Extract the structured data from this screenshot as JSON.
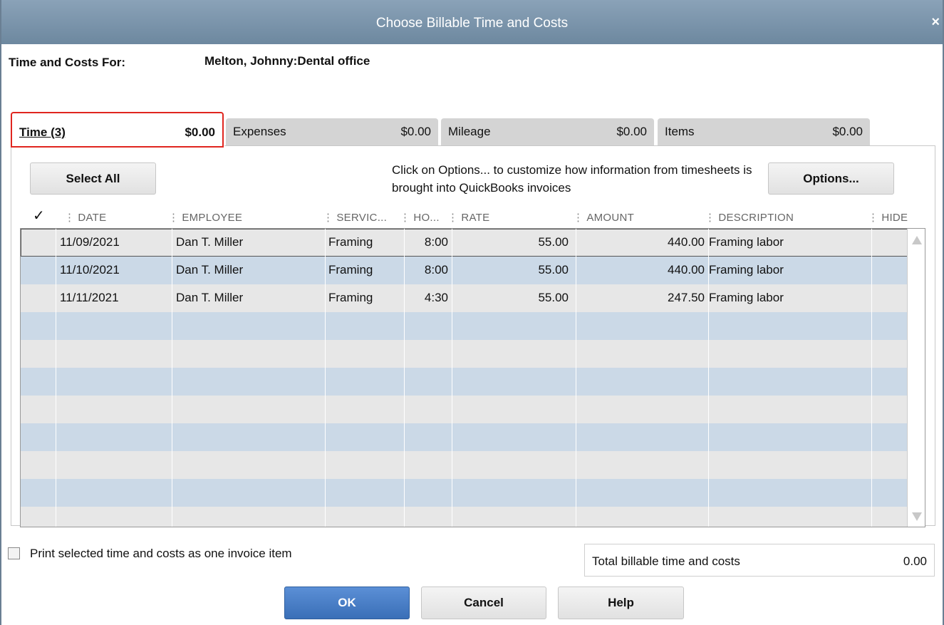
{
  "window": {
    "title": "Choose Billable Time and Costs",
    "close_glyph": "×"
  },
  "header": {
    "label": "Time and Costs For:",
    "value": "Melton, Johnny:Dental office"
  },
  "tabs": [
    {
      "label": "Time (3)",
      "amount": "$0.00",
      "active": true
    },
    {
      "label": "Expenses",
      "amount": "$0.00",
      "active": false
    },
    {
      "label": "Mileage",
      "amount": "$0.00",
      "active": false
    },
    {
      "label": "Items",
      "amount": "$0.00",
      "active": false
    }
  ],
  "toolbar": {
    "select_all_label": "Select All",
    "options_hint": "Click on Options... to customize how information from timesheets is brought into QuickBooks invoices",
    "options_label": "Options..."
  },
  "columns": {
    "check": "✓",
    "date": "DATE",
    "employee": "EMPLOYEE",
    "service": "SERVIC...",
    "hours": "HO...",
    "rate": "RATE",
    "amount": "AMOUNT",
    "description": "DESCRIPTION",
    "hide": "HIDE"
  },
  "rows": [
    {
      "date": "11/09/2021",
      "employee": "Dan T. Miller",
      "service": "Framing",
      "hours": "8:00",
      "rate": "55.00",
      "amount": "440.00",
      "description": "Framing labor"
    },
    {
      "date": "11/10/2021",
      "employee": "Dan T. Miller",
      "service": "Framing",
      "hours": "8:00",
      "rate": "55.00",
      "amount": "440.00",
      "description": "Framing labor"
    },
    {
      "date": "11/11/2021",
      "employee": "Dan T. Miller",
      "service": "Framing",
      "hours": "4:30",
      "rate": "55.00",
      "amount": "247.50",
      "description": "Framing labor"
    }
  ],
  "footer": {
    "print_option_label": "Print selected time and costs as one invoice item",
    "print_option_checked": false,
    "total_label": "Total billable time and costs",
    "total_value": "0.00"
  },
  "buttons": {
    "ok": "OK",
    "cancel": "Cancel",
    "help": "Help"
  },
  "colors": {
    "titlebar": "#7b93aa",
    "active_tab_outline": "#e0261f",
    "row_alt": "#cbd9e7",
    "ok_button": "#4a7fc8"
  },
  "icons": {
    "close": "close-icon",
    "scroll_up": "scroll-up-arrow-icon",
    "scroll_down": "scroll-down-arrow-icon"
  }
}
